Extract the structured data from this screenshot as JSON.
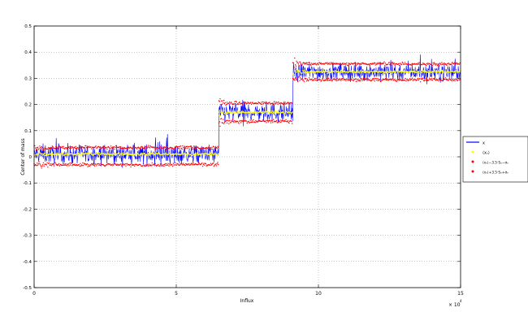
{
  "chart_data": {
    "type": "line",
    "xlabel": "Influx",
    "ylabel": "Center of mass",
    "x_exponent_label": "× 10",
    "x_exponent_power": "4",
    "xlim": [
      0,
      15
    ],
    "ylim": [
      -0.5,
      0.5
    ],
    "x_ticks": [
      0,
      5,
      10,
      15
    ],
    "y_ticks": [
      -0.5,
      -0.4,
      -0.3,
      -0.2,
      -0.1,
      0,
      0.1,
      0.2,
      0.3,
      0.4,
      0.5
    ],
    "x_tick_labels": [
      "0",
      "5",
      "10",
      "15"
    ],
    "y_tick_labels": [
      "-0.5",
      "-0.4",
      "-0.3",
      "-0.2",
      "-0.1",
      "0",
      "0.1",
      "0.2",
      "0.3",
      "0.4",
      "0.5"
    ],
    "grid": true,
    "legend_position": "right",
    "segments": [
      {
        "x_start": 0.0,
        "x_end": 6.5,
        "mean": 0.01,
        "lower": -0.03,
        "upper": 0.035
      },
      {
        "x_start": 6.5,
        "x_end": 9.1,
        "mean": 0.17,
        "lower": 0.135,
        "upper": 0.205
      },
      {
        "x_start": 9.1,
        "x_end": 15.0,
        "mean": 0.325,
        "lower": 0.295,
        "upper": 0.355
      }
    ],
    "series": [
      {
        "name": "x",
        "color": "#0000ff",
        "style": "line"
      },
      {
        "name": "⟨xₙ⟩",
        "color": "#ffff00",
        "style": "dots"
      },
      {
        "name": "⟨xₙ⟩−3.5·Sₙ−σₙ",
        "color": "#ff0000",
        "style": "dots"
      },
      {
        "name": "⟨xₙ⟩+3.5·Sₙ+σₙ",
        "color": "#ff0000",
        "style": "dots"
      }
    ],
    "colors": {
      "signal": "#0000ff",
      "mean": "#ffff00",
      "bounds": "#ff0000",
      "grid": "#888888"
    }
  }
}
